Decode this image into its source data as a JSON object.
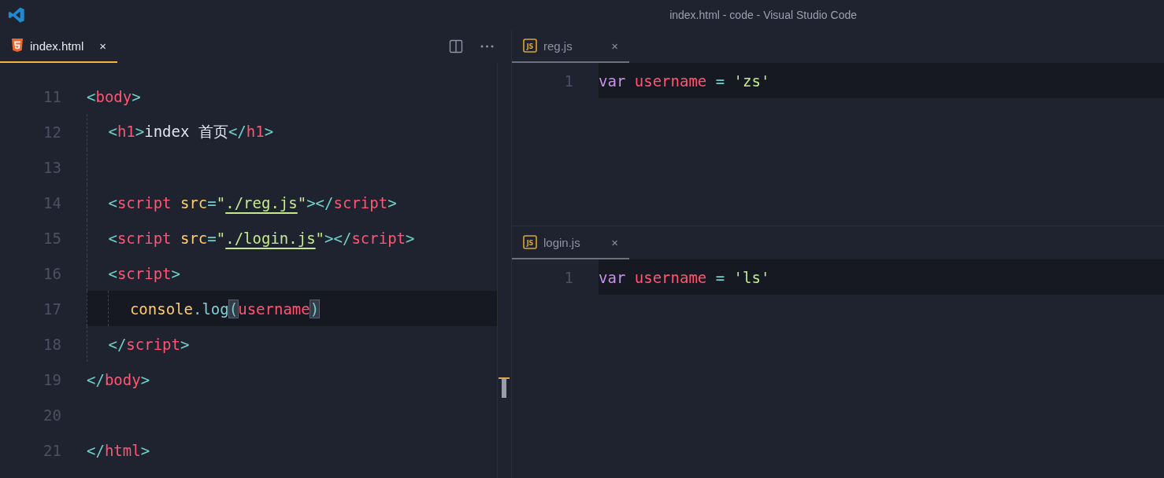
{
  "window": {
    "title": "index.html - code - Visual Studio Code"
  },
  "editor_groups": [
    {
      "focused": true,
      "actions": [
        {
          "kind": "split"
        },
        {
          "kind": "more"
        }
      ],
      "tab": {
        "label": "index.html",
        "kind": "html",
        "selected": true,
        "close": "×"
      },
      "lines": [
        {
          "number": "11",
          "current": false,
          "tokens": [
            {
              "text": "<",
              "kind": "punct"
            },
            {
              "text": "body",
              "kind": "tag"
            },
            {
              "text": ">",
              "kind": "punct"
            }
          ],
          "children": [
            {
              "number": "12",
              "current": false,
              "tokens": [
                {
                  "text": "<",
                  "kind": "punct"
                },
                {
                  "text": "h1",
                  "kind": "tag"
                },
                {
                  "text": ">",
                  "kind": "punct"
                },
                {
                  "text": "index 首页",
                  "kind": "plain"
                },
                {
                  "text": "</",
                  "kind": "punct"
                },
                {
                  "text": "h1",
                  "kind": "tag"
                },
                {
                  "text": ">",
                  "kind": "punct"
                }
              ]
            },
            {
              "number": "13",
              "current": false
            },
            {
              "number": "14",
              "current": false,
              "tokens": [
                {
                  "text": "<",
                  "kind": "punct"
                },
                {
                  "text": "script",
                  "kind": "tag"
                },
                {
                  "text": " src",
                  "kind": "attr"
                },
                {
                  "text": "=",
                  "kind": "punct"
                },
                {
                  "text": "\"",
                  "kind": "string"
                },
                {
                  "text": "./reg.js",
                  "kind": "link"
                },
                {
                  "text": "\"",
                  "kind": "string"
                },
                {
                  "text": "></",
                  "kind": "punct"
                },
                {
                  "text": "script",
                  "kind": "tag"
                },
                {
                  "text": ">",
                  "kind": "punct"
                }
              ]
            },
            {
              "number": "15",
              "current": false,
              "tokens": [
                {
                  "text": "<",
                  "kind": "punct"
                },
                {
                  "text": "script",
                  "kind": "tag"
                },
                {
                  "text": " src",
                  "kind": "attr"
                },
                {
                  "text": "=",
                  "kind": "punct"
                },
                {
                  "text": "\"",
                  "kind": "string"
                },
                {
                  "text": "./login.js",
                  "kind": "link"
                },
                {
                  "text": "\"",
                  "kind": "string"
                },
                {
                  "text": "></",
                  "kind": "punct"
                },
                {
                  "text": "script",
                  "kind": "tag"
                },
                {
                  "text": ">",
                  "kind": "punct"
                }
              ]
            },
            {
              "number": "16",
              "current": false,
              "tokens": [
                {
                  "text": "<",
                  "kind": "punct"
                },
                {
                  "text": "script",
                  "kind": "tag"
                },
                {
                  "text": ">",
                  "kind": "punct"
                }
              ],
              "children": [
                {
                  "number": "17",
                  "current": true,
                  "tokens": [
                    {
                      "text": "console",
                      "kind": "object"
                    },
                    {
                      "text": ".",
                      "kind": "punct"
                    },
                    {
                      "text": "log",
                      "kind": "method"
                    },
                    {
                      "text": "(",
                      "kind": "matched-bracket"
                    },
                    {
                      "text": "username",
                      "kind": "variable"
                    },
                    {
                      "text": ")",
                      "kind": "matched-bracket"
                    }
                  ]
                }
              ]
            },
            {
              "number": "18",
              "current": false,
              "tokens": [
                {
                  "text": "</",
                  "kind": "punct"
                },
                {
                  "text": "script",
                  "kind": "tag"
                },
                {
                  "text": ">",
                  "kind": "punct"
                }
              ]
            }
          ]
        },
        {
          "number": "19",
          "current": false,
          "tokens": [
            {
              "text": "</",
              "kind": "punct"
            },
            {
              "text": "body",
              "kind": "tag"
            },
            {
              "text": ">",
              "kind": "punct"
            }
          ]
        },
        {
          "number": "20",
          "current": false
        },
        {
          "number": "21",
          "current": false,
          "tokens": [
            {
              "text": "</",
              "kind": "punct"
            },
            {
              "text": "html",
              "kind": "tag"
            },
            {
              "text": ">",
              "kind": "punct"
            }
          ]
        }
      ]
    },
    {
      "focused": false,
      "tab": {
        "label": "reg.js",
        "kind": "js",
        "icon_text": "JS",
        "selected": true,
        "close": "×"
      },
      "lines": [
        {
          "number": "1",
          "current": true,
          "tokens": [
            {
              "text": "var",
              "kind": "keyword"
            },
            {
              "text": " username",
              "kind": "variable"
            },
            {
              "text": " = ",
              "kind": "punct"
            },
            {
              "text": "'zs'",
              "kind": "string"
            }
          ]
        }
      ]
    },
    {
      "focused": false,
      "tab": {
        "label": "login.js",
        "kind": "js",
        "icon_text": "JS",
        "selected": true,
        "close": "×"
      },
      "lines": [
        {
          "number": "1",
          "current": true,
          "tokens": [
            {
              "text": "var",
              "kind": "keyword"
            },
            {
              "text": " username",
              "kind": "variable"
            },
            {
              "text": " = ",
              "kind": "punct"
            },
            {
              "text": "'ls'",
              "kind": "string"
            }
          ]
        }
      ]
    }
  ]
}
